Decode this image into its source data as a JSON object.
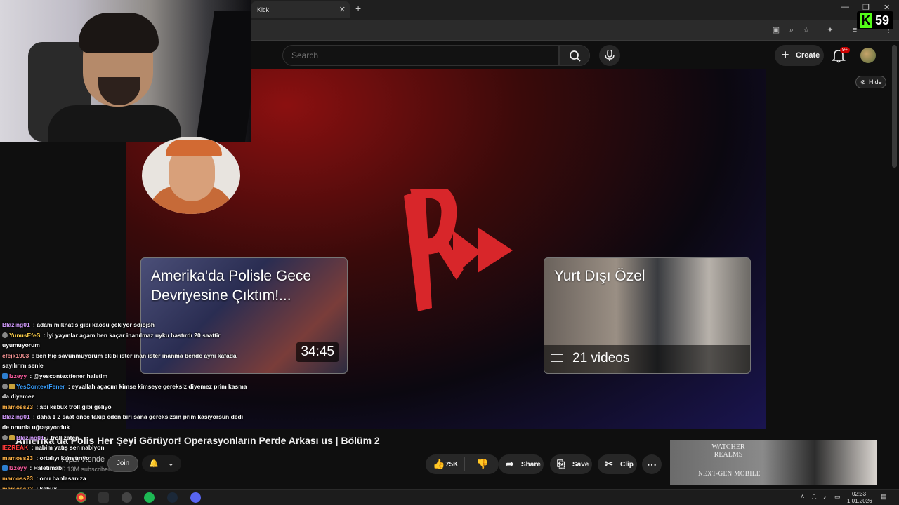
{
  "browser": {
    "tab_title": "Kick",
    "tab_close": "✕",
    "new_tab": "+",
    "window_minimize": "—",
    "window_restore": "❐",
    "window_close": "✕"
  },
  "header": {
    "search_placeholder": "Search",
    "create_label": "Create",
    "notification_badge": "9+"
  },
  "banner": {
    "cards": [
      {
        "title": "Amerika'da Polisle Gece Devriyesine Çıktım!...",
        "duration": "34:45"
      },
      {
        "title": "Yurt Dışı Özel",
        "playlist_count": "21 videos"
      }
    ],
    "hide_label": "Hide"
  },
  "video": {
    "title": "Amerika'da Polis Her Şeyi Görüyor! Operasyonların Perde Arkası us | Bölüm 2",
    "channel_name": "Alper Rende",
    "channel_subs": "6.13M subscribers",
    "join_label": "Join",
    "notif_icon": "🔔",
    "notif_chevron": "⌄",
    "actions": {
      "like_count": "75K",
      "share": "Share",
      "save": "Save",
      "clip": "Clip",
      "more": "⋯"
    }
  },
  "ad": {
    "brand_line1": "WATCHER",
    "brand_line2": "REALMS",
    "tagline": "NEXT-GEN MOBILE"
  },
  "stream": {
    "viewer_count": "59",
    "kick_letter": "K"
  },
  "chat": [
    {
      "user": "Blazing01",
      "color": "#d49cff",
      "text": "adam mıknatıs gibi kaosu çekiyor sdıojsh"
    },
    {
      "user": "YunusEfeS",
      "color": "#ffd04a",
      "text": "İyi yayınlar agam ben kaçar inanılmaz uyku bastırdı 20 saattir uyumuyorum"
    },
    {
      "user": "efejk1903",
      "color": "#ff9a9a",
      "text": "ben hiç savunmuyorum ekibi ister inan ister inanma bende aynı kafada sayılırım senle"
    },
    {
      "user": "Izzeyy",
      "color": "#ff5fa2",
      "text": "@yescontextfener haletim"
    },
    {
      "user": "YesContextFener",
      "color": "#3aa0ff",
      "text": "eyvallah agacım kimse kimseye gereksiz diyemez prim kasma da diyemez"
    },
    {
      "user": "mamoss23",
      "color": "#ffb347",
      "text": "abi ksbux troll gibi geliyo"
    },
    {
      "user": "Blazing01",
      "color": "#d49cff",
      "text": "daha 1 2 saat önce takip eden biri sana gereksizsin prim kasıyorsun dedi de onunla uğraşıyorduk"
    },
    {
      "user": "Blazing01",
      "color": "#d49cff",
      "text": "troll zaten"
    },
    {
      "user": "IEZREAK",
      "color": "#ff3b3b",
      "text": "nabim yatış sen nabiyon"
    },
    {
      "user": "mamoss23",
      "color": "#ffb347",
      "text": "ortalıyı karıştırıyo"
    },
    {
      "user": "Izzeyy",
      "color": "#ff5fa2",
      "text": "Haletimabi"
    },
    {
      "user": "mamoss23",
      "color": "#ffb347",
      "text": "onu banlasanıza"
    },
    {
      "user": "mamoss23",
      "color": "#ffb347",
      "text": "ksbux"
    }
  ],
  "taskbar": {
    "time": "02:33",
    "date": "1.01.2026"
  },
  "colors": {
    "accent_kick": "#53fc18",
    "logo_red": "#d8262a",
    "badge_red": "#cc0000"
  }
}
